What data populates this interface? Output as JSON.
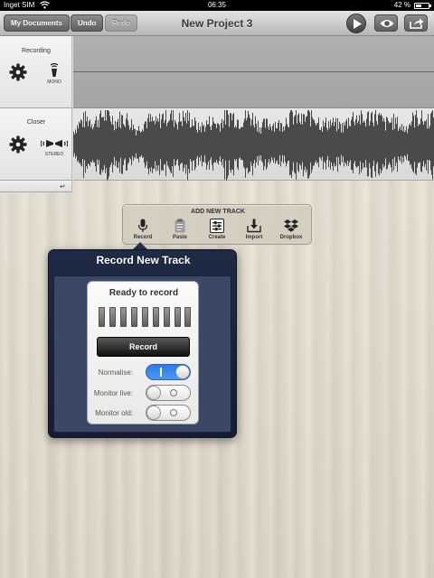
{
  "status_bar": {
    "carrier": "Inget SIM",
    "time": "06:35",
    "battery": "42 %",
    "battery_level": 0.42
  },
  "toolbar": {
    "my_documents": "My Documents",
    "undo": "Undo",
    "redo": "Redo",
    "title": "New Project 3"
  },
  "tracks": [
    {
      "name": "Recording",
      "mode": "MONO",
      "muted_lane": true
    },
    {
      "name": "Closer",
      "mode": "STEREO",
      "muted_lane": false
    }
  ],
  "add_track": {
    "title": "ADD NEW TRACK",
    "items": [
      {
        "label": "Record",
        "icon": "microphone-icon"
      },
      {
        "label": "Paste",
        "icon": "clipboard-icon"
      },
      {
        "label": "Create",
        "icon": "sliders-icon"
      },
      {
        "label": "Import",
        "icon": "import-icon"
      },
      {
        "label": "Dropbox",
        "icon": "dropbox-icon"
      }
    ]
  },
  "record_popover": {
    "title": "Record New Track",
    "status": "Ready to record",
    "record_button": "Record",
    "options": [
      {
        "label": "Normalise:",
        "on": true
      },
      {
        "label": "Monitor live:",
        "on": false
      },
      {
        "label": "Monitor old:",
        "on": false
      }
    ]
  }
}
